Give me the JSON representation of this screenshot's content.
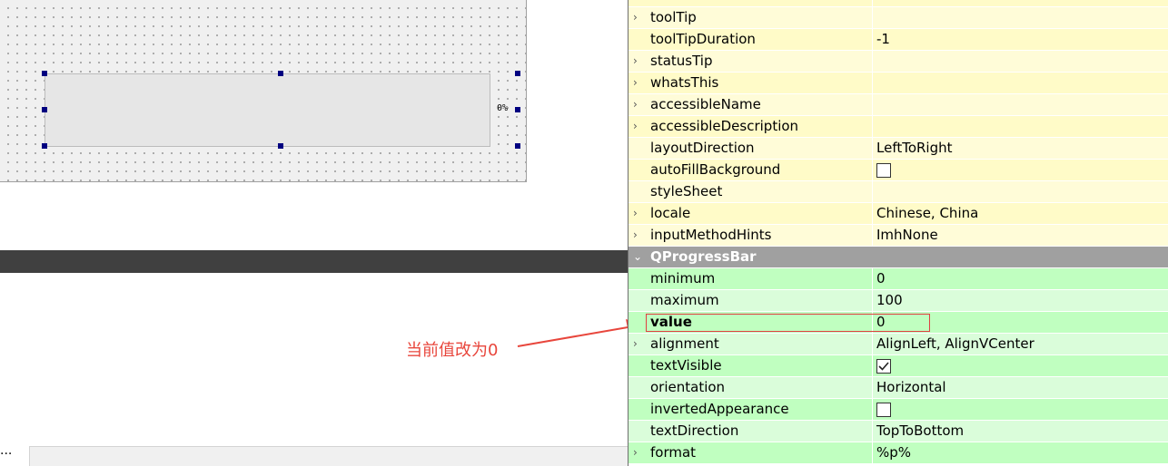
{
  "designer": {
    "progress_text": "0%",
    "ellipsis": "..."
  },
  "annotation": {
    "text": "当前值改为0",
    "color": "#e8463c"
  },
  "property_editor": {
    "top_partial": {
      "name": "",
      "value": "…"
    },
    "rows": [
      {
        "name": "toolTip",
        "value": "",
        "expandable": true,
        "band": "yellow-b"
      },
      {
        "name": "toolTipDuration",
        "value": "-1",
        "expandable": false,
        "band": "yellow-a"
      },
      {
        "name": "statusTip",
        "value": "",
        "expandable": true,
        "band": "yellow-b"
      },
      {
        "name": "whatsThis",
        "value": "",
        "expandable": true,
        "band": "yellow-a"
      },
      {
        "name": "accessibleName",
        "value": "",
        "expandable": true,
        "band": "yellow-b"
      },
      {
        "name": "accessibleDescription",
        "value": "",
        "expandable": true,
        "band": "yellow-a"
      },
      {
        "name": "layoutDirection",
        "value": "LeftToRight",
        "expandable": false,
        "band": "yellow-b"
      },
      {
        "name": "autoFillBackground",
        "value": "",
        "checkbox": false,
        "expandable": false,
        "band": "yellow-a"
      },
      {
        "name": "styleSheet",
        "value": "",
        "expandable": false,
        "band": "yellow-b"
      },
      {
        "name": "locale",
        "value": "Chinese, China",
        "expandable": true,
        "band": "yellow-a"
      },
      {
        "name": "inputMethodHints",
        "value": "ImhNone",
        "expandable": true,
        "band": "yellow-b"
      }
    ],
    "section_header": "QProgressBar",
    "section_rows": [
      {
        "name": "minimum",
        "value": "0",
        "expandable": false,
        "band": "green-a"
      },
      {
        "name": "maximum",
        "value": "100",
        "expandable": false,
        "band": "green-b"
      },
      {
        "name": "value",
        "value": "0",
        "expandable": false,
        "band": "green-a",
        "bold": true
      },
      {
        "name": "alignment",
        "value": "AlignLeft, AlignVCenter",
        "expandable": true,
        "band": "green-b"
      },
      {
        "name": "textVisible",
        "value": "",
        "checkbox": true,
        "expandable": false,
        "band": "green-a"
      },
      {
        "name": "orientation",
        "value": "Horizontal",
        "expandable": false,
        "band": "green-b"
      },
      {
        "name": "invertedAppearance",
        "value": "",
        "checkbox": false,
        "expandable": false,
        "band": "green-a"
      },
      {
        "name": "textDirection",
        "value": "TopToBottom",
        "expandable": false,
        "band": "green-b"
      },
      {
        "name": "format",
        "value": "%p%",
        "expandable": true,
        "band": "green-a"
      }
    ]
  }
}
